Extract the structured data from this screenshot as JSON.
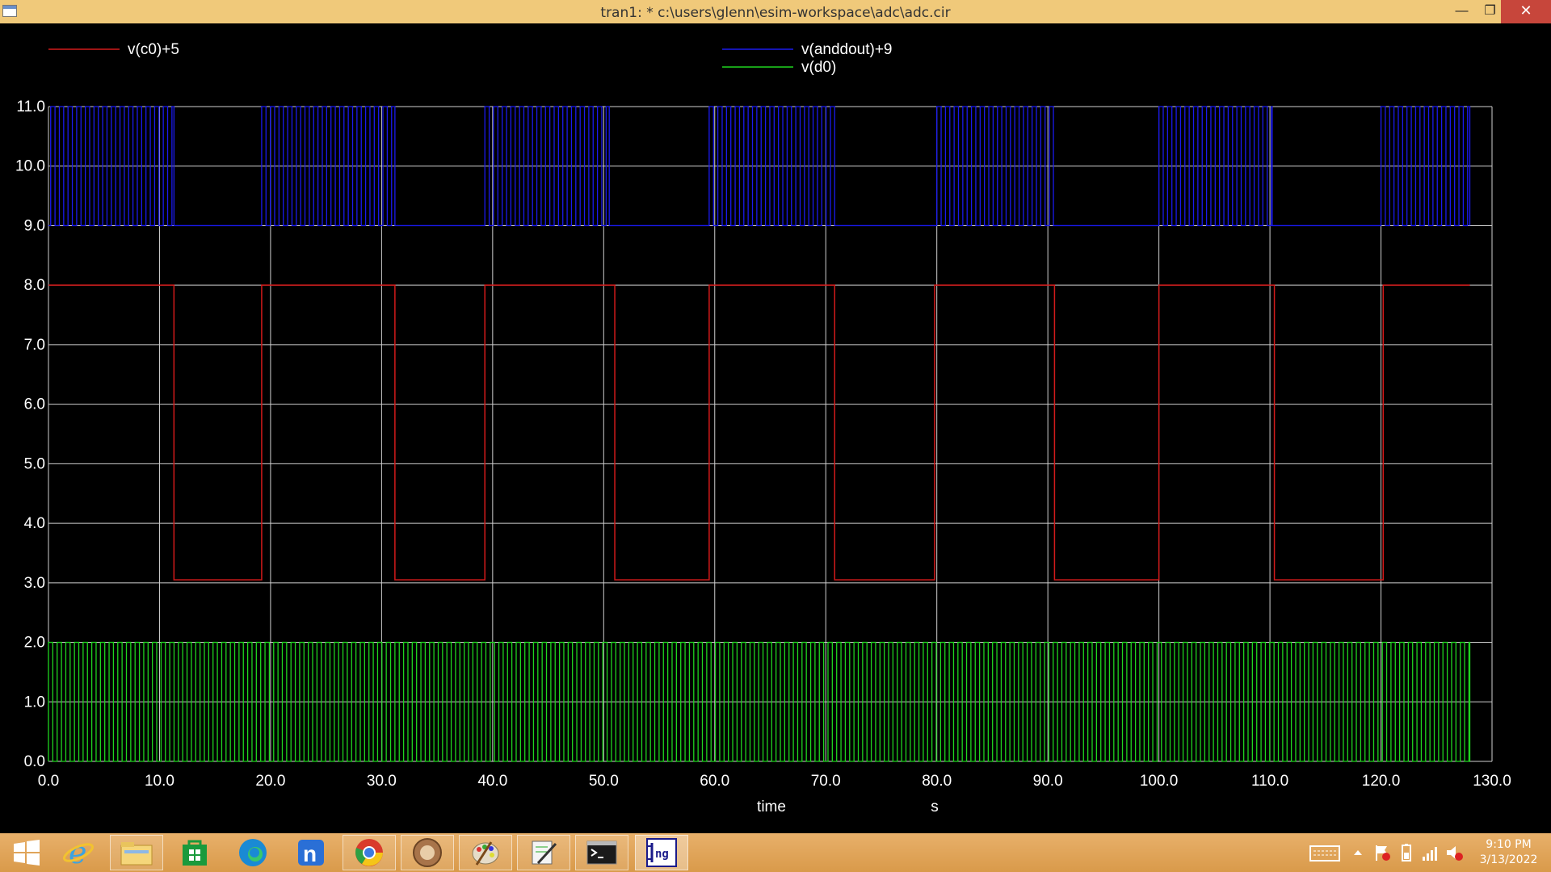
{
  "window": {
    "title": "tran1: * c:\\users\\glenn\\esim-workspace\\adc\\adc.cir",
    "minimize_label": "—",
    "maximize_label": "❐",
    "close_label": "✕"
  },
  "chart_data": {
    "type": "line",
    "title": "",
    "xlabel": "time",
    "xunit": "s",
    "ylabel": "",
    "xlim": [
      0,
      130
    ],
    "ylim": [
      0,
      11
    ],
    "x_ticks": [
      "0.0",
      "10.0",
      "20.0",
      "30.0",
      "40.0",
      "50.0",
      "60.0",
      "70.0",
      "80.0",
      "90.0",
      "100.0",
      "110.0",
      "120.0",
      "130.0"
    ],
    "y_ticks": [
      "0.0",
      "1.0",
      "2.0",
      "3.0",
      "4.0",
      "5.0",
      "6.0",
      "7.0",
      "8.0",
      "9.0",
      "10.0",
      "11.0"
    ],
    "grid": true,
    "background": "#000000",
    "series": [
      {
        "name": "v(c0)+5",
        "color": "#d21a1a",
        "high": 8,
        "low": 3.05,
        "low_intervals": [
          [
            11.3,
            19.2
          ],
          [
            31.2,
            39.3
          ],
          [
            51.0,
            59.5
          ],
          [
            70.8,
            79.8
          ],
          [
            90.6,
            100.0
          ],
          [
            110.4,
            120.2
          ]
        ],
        "x_end": 128
      },
      {
        "name": "v(anddout)+9",
        "color": "#1a1aee",
        "high": 11,
        "low": 9,
        "burst_intervals": [
          [
            0.2,
            11.3
          ],
          [
            19.2,
            31.2
          ],
          [
            39.3,
            50.5
          ],
          [
            59.5,
            70.8
          ],
          [
            80.0,
            90.5
          ],
          [
            100.0,
            110.2
          ],
          [
            120.0,
            128
          ]
        ],
        "period": 0.78,
        "x_end": 128
      },
      {
        "name": "v(d0)",
        "color": "#1fd41f",
        "high": 2,
        "low": 0,
        "period": 0.78,
        "x_end": 128
      }
    ]
  },
  "taskbar": {
    "apps": [
      "start-button",
      "internet-explorer",
      "file-explorer",
      "store",
      "edge",
      "notepad-n",
      "chrome",
      "media-app",
      "paint",
      "notes-app",
      "terminal",
      "ngspice"
    ],
    "clock_time": "9:10 PM",
    "clock_date": "3/13/2022"
  }
}
